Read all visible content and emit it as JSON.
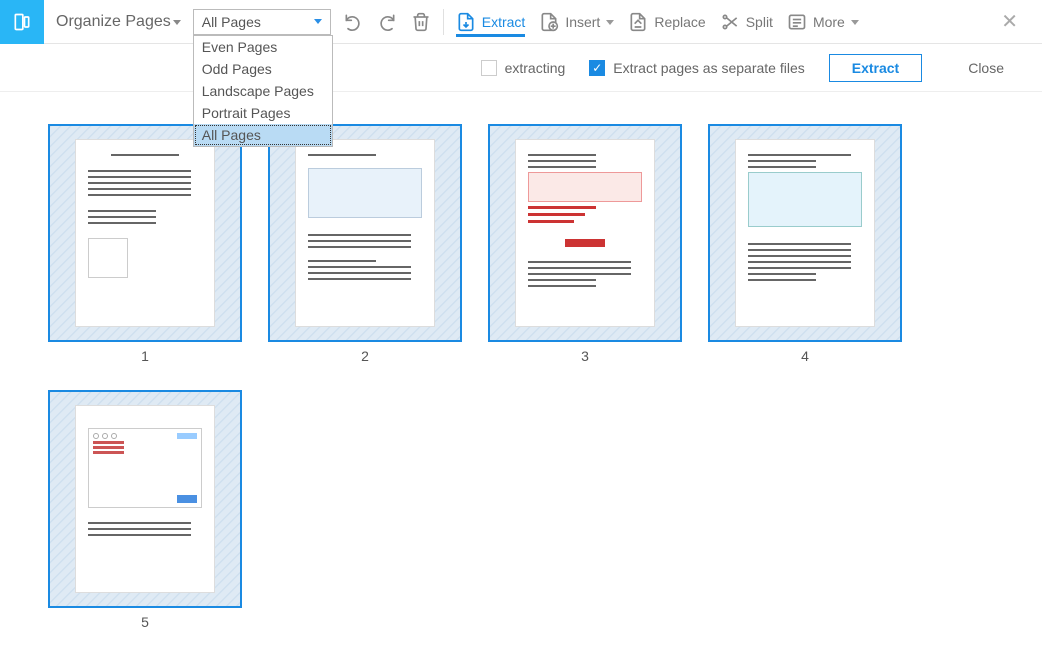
{
  "toolbar": {
    "title": "Organize Pages",
    "page_select_value": "All Pages",
    "dropdown_options": [
      "Even Pages",
      "Odd Pages",
      "Landscape Pages",
      "Portrait Pages",
      "All Pages"
    ],
    "selected_option_index": 4,
    "extract": "Extract",
    "insert": "Insert",
    "replace": "Replace",
    "split": "Split",
    "more": "More"
  },
  "subbar": {
    "delete_after": "extracting",
    "separate_files": "Extract pages as separate files",
    "extract_btn": "Extract",
    "close_btn": "Close"
  },
  "pages": [
    "1",
    "2",
    "3",
    "4",
    "5"
  ]
}
